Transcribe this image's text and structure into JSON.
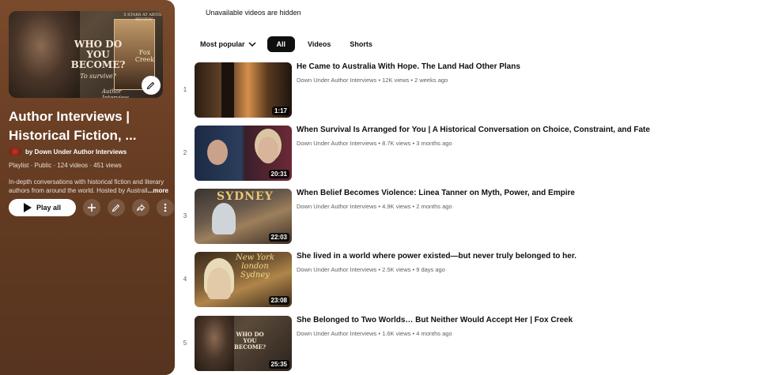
{
  "notice": "Unavailable videos are hidden",
  "playlist": {
    "title": "Author Interviews | Historical Fiction, ...",
    "owner": "by Down Under Author Interviews",
    "meta": "Playlist · Public · 124 videos · 451 views",
    "description": "In-depth conversations with historical fiction and literary authors from around the world. Hosted by Australi",
    "more_label": "...more",
    "play_all_label": "Play all",
    "thumbnail": {
      "badge": "5 STARS AT ARTIST REVIEW",
      "headline": "WHO DO YOU BECOME?",
      "subline": "To survive?",
      "book": "Fox Creek",
      "caption": "Author Interview"
    }
  },
  "filters": {
    "sort_label": "Most popular",
    "chips": [
      "All",
      "Videos",
      "Shorts"
    ],
    "active_chip": "All"
  },
  "videos": [
    {
      "index": "1",
      "title": "He Came to Australia With Hope. The Land Had Other Plans",
      "channel": "Down Under Author Interviews",
      "views": "12K views",
      "age": "2 weeks ago",
      "duration": "1:17",
      "progress": 0.0
    },
    {
      "index": "2",
      "title": "When Survival Is Arranged for You | A Historical Conversation on Choice, Constraint, and Fate",
      "channel": "Down Under Author Interviews",
      "views": "8.7K views",
      "age": "3 months ago",
      "duration": "20:31",
      "progress": 0.0
    },
    {
      "index": "3",
      "title": "When Belief Becomes Violence: Linea Tanner on Myth, Power, and Empire",
      "channel": "Down Under Author Interviews",
      "views": "4.9K views",
      "age": "2 months ago",
      "duration": "22:03",
      "progress": 0.0
    },
    {
      "index": "4",
      "title": "She lived in a world where power existed—but never truly belonged to her.",
      "channel": "Down Under Author Interviews",
      "views": "2.5K views",
      "age": "9 days ago",
      "duration": "23:08",
      "progress": 0.0
    },
    {
      "index": "5",
      "title": "She Belonged to Two Worlds… But Neither Would Accept Her | Fox Creek",
      "channel": "Down Under Author Interviews",
      "views": "1.6K views",
      "age": "4 months ago",
      "duration": "25:35",
      "progress": 0.0
    }
  ]
}
